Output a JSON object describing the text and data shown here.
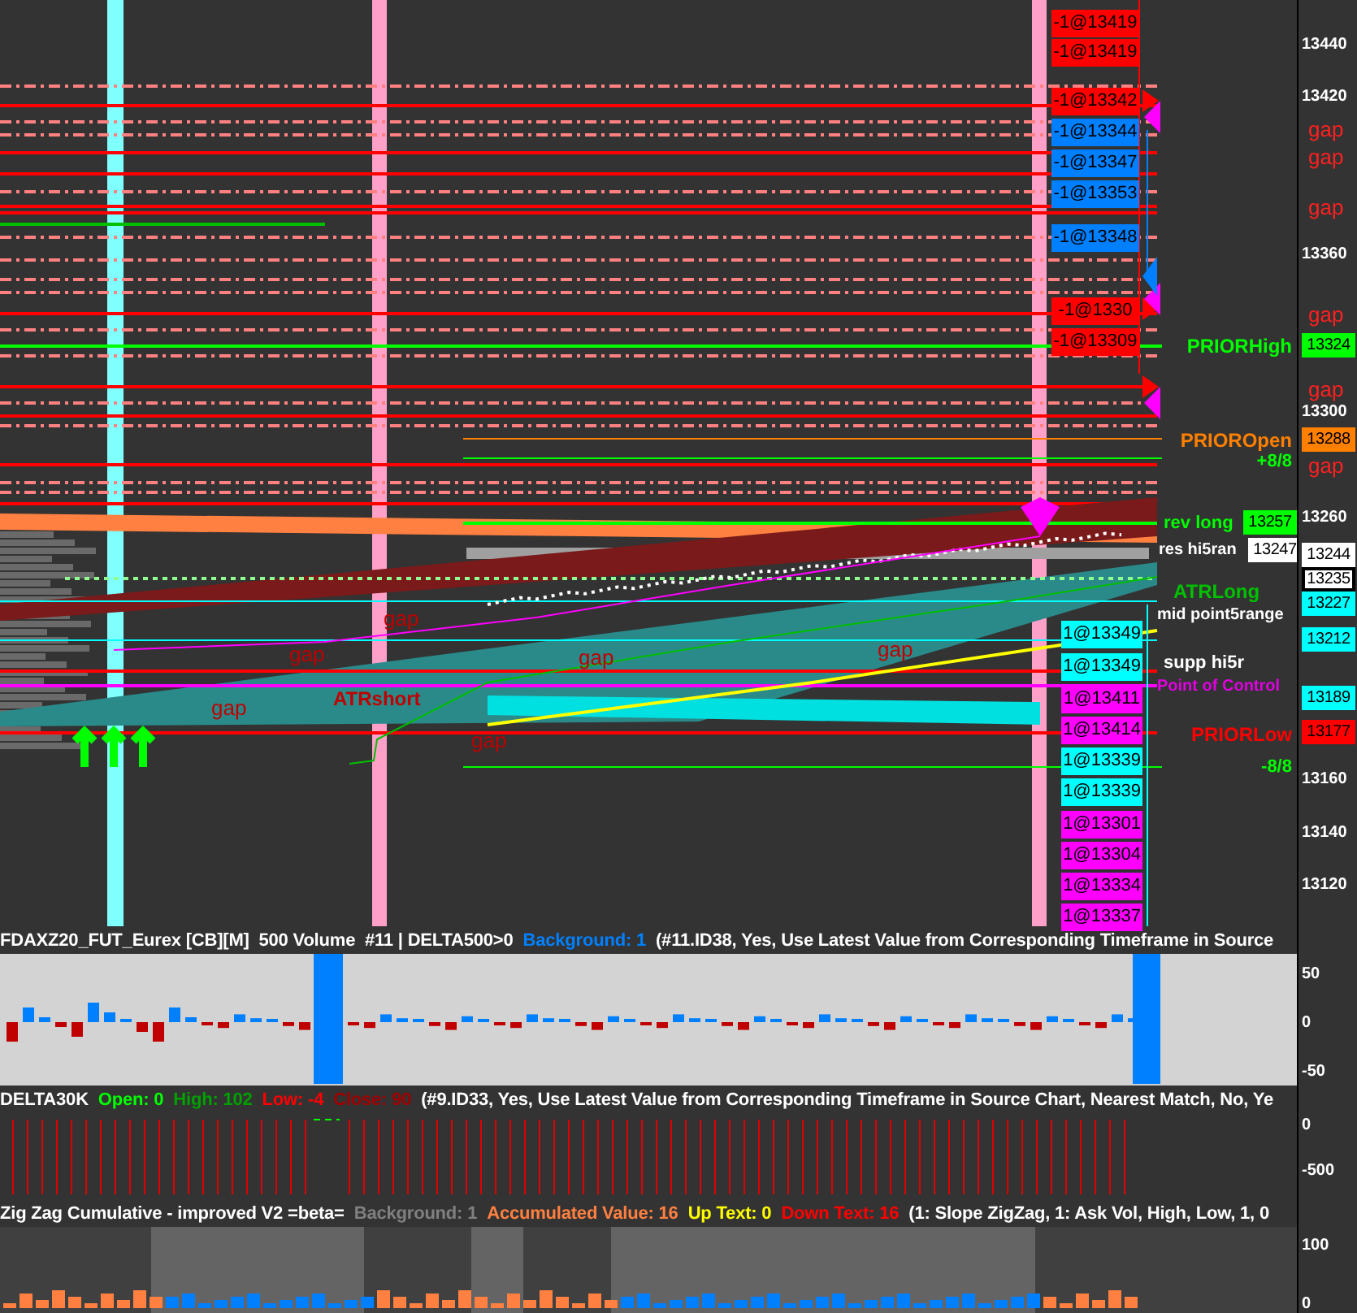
{
  "main_chart": {
    "sell_orders": [
      {
        "text": "-1@13419",
        "color": "#ff0000"
      },
      {
        "text": "-1@13419",
        "color": "#ff0000"
      },
      {
        "text": "-1@13342",
        "color": "#ff0000"
      },
      {
        "text": "-1@13344",
        "color": "#0080ff"
      },
      {
        "text": "-1@13347",
        "color": "#0080ff"
      },
      {
        "text": "-1@13353",
        "color": "#0080ff"
      },
      {
        "text": "-1@13348",
        "color": "#0080ff"
      },
      {
        "text": "-1@1330",
        "color": "#ff0000"
      },
      {
        "text": "-1@13309",
        "color": "#ff0000"
      }
    ],
    "buy_orders": [
      {
        "text": "1@13349",
        "color": "#00ffff"
      },
      {
        "text": "1@13349",
        "color": "#00ffff"
      },
      {
        "text": "1@13411",
        "color": "#ff00ff"
      },
      {
        "text": "1@13414",
        "color": "#ff00ff"
      },
      {
        "text": "1@13339",
        "color": "#00ffff"
      },
      {
        "text": "1@13339",
        "color": "#00ffff"
      },
      {
        "text": "1@13301",
        "color": "#ff00ff"
      },
      {
        "text": "1@13304",
        "color": "#ff00ff"
      },
      {
        "text": "1@13334",
        "color": "#ff00ff"
      },
      {
        "text": "1@13337",
        "color": "#ff00ff"
      }
    ],
    "level_labels": [
      {
        "text": "PRIORHigh",
        "color": "#00ff00"
      },
      {
        "text": "PRIOROpen",
        "color": "#ff8000"
      },
      {
        "text": "+8/8",
        "color": "#00ff00"
      },
      {
        "text": "rev long",
        "color": "#00ff00"
      },
      {
        "text": "res hi5ran",
        "color": "#ffffff"
      },
      {
        "text": "ATRLong",
        "color": "#00c000"
      },
      {
        "text": "mid point5range",
        "color": "#ffffff"
      },
      {
        "text": "supp hi5r",
        "color": "#ffffff"
      },
      {
        "text": "Point of Control",
        "color": "#e000e0"
      },
      {
        "text": "PRIORLow",
        "color": "#ff0000"
      },
      {
        "text": "-8/8",
        "color": "#00ff00"
      },
      {
        "text": "ATRshort",
        "color": "#c00000"
      }
    ],
    "chart_gap_labels": [
      "gap",
      "gap",
      "gap",
      "gap",
      "gap",
      "gap"
    ],
    "axis_gap_labels": [
      "gap",
      "gap",
      "gap",
      "gap",
      "gap",
      "gap"
    ],
    "price_badges": [
      {
        "text": "13324",
        "color": "#00ff00"
      },
      {
        "text": "13288",
        "color": "#ff8000"
      },
      {
        "text": "13257",
        "color": "#00ff00"
      },
      {
        "text": "13247",
        "color": "#ffffff"
      },
      {
        "text": "13244",
        "color": "#ffffff"
      },
      {
        "text": "13235",
        "color": "#ffffff"
      },
      {
        "text": "13227",
        "color": "#00ffff"
      },
      {
        "text": "13212",
        "color": "#00ffff"
      },
      {
        "text": "13189",
        "color": "#00ffff"
      },
      {
        "text": "13177",
        "color": "#ff0000"
      }
    ],
    "axis_ticks": [
      "13440",
      "13420",
      "13360",
      "13300",
      "13260",
      "13160",
      "13140",
      "13120"
    ]
  },
  "panes": [
    {
      "kind": "delta_histogram",
      "header": [
        {
          "text": "FDAXZ20_FUT_Eurex [CB][M]  500 Volume  #11 | DELTA500>0",
          "color": "#ffffff"
        },
        {
          "text": "Background: 1",
          "color": "#0080ff"
        },
        {
          "text": "(#11.ID38, Yes, Use Latest Value from Corresponding Timeframe in Source",
          "color": "#ffffff"
        }
      ],
      "axis_ticks": [
        "50",
        "0",
        "-50"
      ]
    },
    {
      "kind": "delta_lines",
      "header": [
        {
          "text": "DELTA30K",
          "color": "#ffffff"
        },
        {
          "text": "Open: 0",
          "color": "#00ff00"
        },
        {
          "text": "High: 102",
          "color": "#00a000"
        },
        {
          "text": "Low: -4",
          "color": "#ff0000"
        },
        {
          "text": "Close: 90",
          "color": "#a00000"
        },
        {
          "text": "(#9.ID33, Yes, Use Latest Value from Corresponding Timeframe in Source Chart, Nearest Match, No, Ye",
          "color": "#ffffff"
        }
      ],
      "axis_ticks": [
        "0",
        "-500"
      ]
    },
    {
      "kind": "zigzag_bars",
      "header": [
        {
          "text": "Zig Zag Cumulative - improved V2 =beta=",
          "color": "#ffffff"
        },
        {
          "text": "Background: 1",
          "color": "#808080"
        },
        {
          "text": "Accumulated Value: 16",
          "color": "#ff8040"
        },
        {
          "text": "Up Text: 0",
          "color": "#ffff00"
        },
        {
          "text": "Down Text: 16",
          "color": "#ff0000"
        },
        {
          "text": "(1: Slope ZigZag, 1: Ask Vol, High, Low, 1, 0",
          "color": "#ffffff"
        }
      ],
      "axis_ticks": [
        "100",
        "0"
      ]
    }
  ]
}
